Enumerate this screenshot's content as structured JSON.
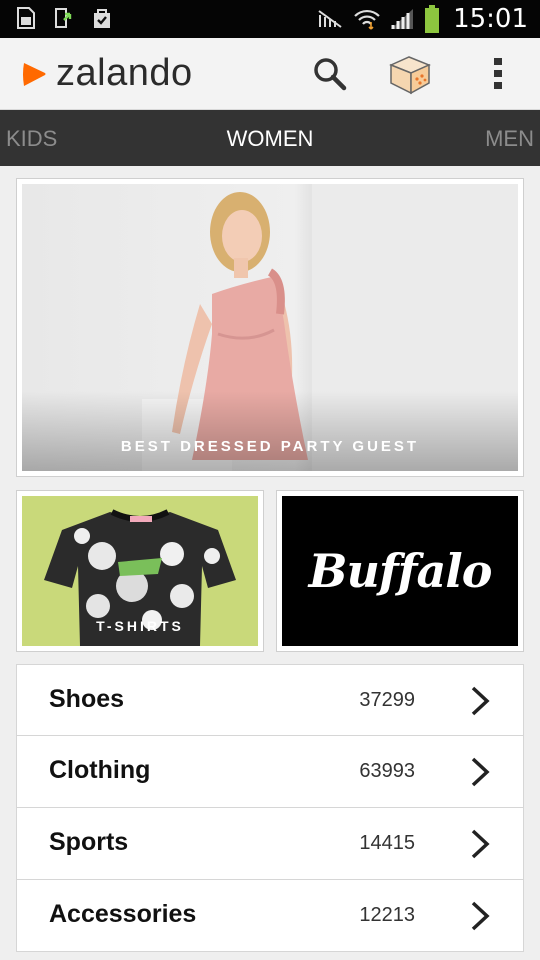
{
  "status_bar": {
    "time": "15:01",
    "icons": [
      "sim-card-icon",
      "download-icon",
      "shopping-bag-check-icon",
      "no-signal-icon",
      "wifi-icon",
      "cell-signal-icon",
      "battery-icon"
    ]
  },
  "app_bar": {
    "brand": "zalando",
    "brand_color": "#ff6900",
    "actions": [
      "search-icon",
      "box-icon",
      "overflow-menu-icon"
    ]
  },
  "tabs": {
    "left": "KIDS",
    "active": "WOMEN",
    "right": "MEN"
  },
  "hero": {
    "caption": "BEST DRESSED PARTY GUEST"
  },
  "tiles": {
    "left_caption": "T-SHIRTS",
    "right_brand": "Buffalo"
  },
  "categories": [
    {
      "label": "Shoes",
      "count": "37299"
    },
    {
      "label": "Clothing",
      "count": "63993"
    },
    {
      "label": "Sports",
      "count": "14415"
    },
    {
      "label": "Accessories",
      "count": "12213"
    }
  ]
}
